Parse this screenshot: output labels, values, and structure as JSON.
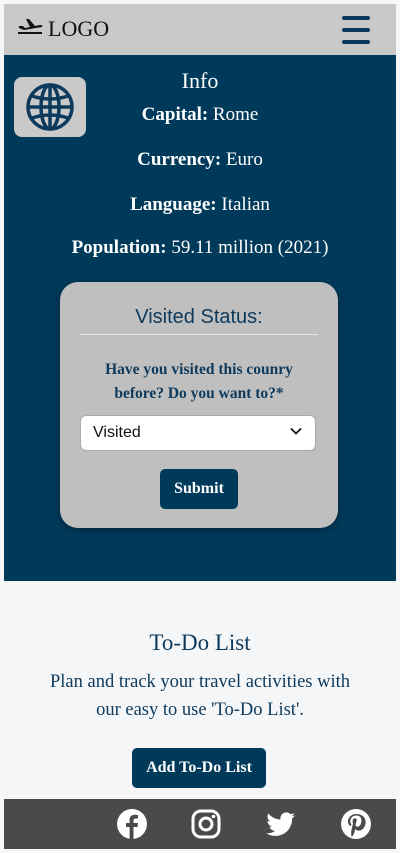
{
  "header": {
    "logo_text": "LOGO"
  },
  "info": {
    "title": "Info",
    "facts": [
      {
        "label": "Capital:",
        "value": "Rome"
      },
      {
        "label": "Currency:",
        "value": "Euro"
      },
      {
        "label": "Language:",
        "value": "Italian"
      },
      {
        "label": "Population:",
        "value": "59.11 million (2021)"
      }
    ]
  },
  "visited": {
    "title": "Visited Status:",
    "question": "Have you visited this counry before? Do you want to?*",
    "selected_option": "Visited",
    "submit_label": "Submit"
  },
  "todo": {
    "title": "To-Do List",
    "text": "Plan and track your travel activities with our easy to use 'To-Do List'.",
    "button_label": "Add To-Do List"
  },
  "footer": {
    "social_icons": [
      "facebook-icon",
      "instagram-icon",
      "twitter-icon",
      "pinterest-icon"
    ]
  },
  "colors": {
    "primary": "#003a5a",
    "header_bg": "#c8c8c8",
    "card_bg": "#bfbfbf",
    "footer_bg": "#4a4a4a",
    "page_bg": "#f5f6f8"
  }
}
